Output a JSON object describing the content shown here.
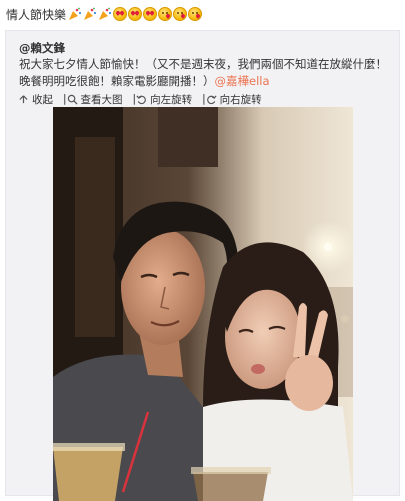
{
  "post": {
    "title": "情人節快樂",
    "emojis": [
      "party-popper",
      "party-popper",
      "party-popper",
      "heart-eyes",
      "heart-eyes",
      "heart-eyes",
      "kiss",
      "kiss",
      "kiss"
    ]
  },
  "repost": {
    "author": "@賴文鋒",
    "text_main": "祝大家七夕情人節愉快！（又不是週末夜，我們兩個不知道在放縱什麼！晚餐明明吃很飽！賴家電影廳開播！）",
    "mention": "@嘉樺ella",
    "actions": [
      {
        "label": "收起",
        "icon": "collapse-icon"
      },
      {
        "label": "查看大图",
        "icon": "zoom-icon"
      },
      {
        "label": "向左旋转",
        "icon": "rotate-left-icon"
      },
      {
        "label": "向右旋转",
        "icon": "rotate-right-icon"
      }
    ]
  },
  "colors": {
    "card_background": "#f2f2f5",
    "mention": "#eb7350"
  }
}
